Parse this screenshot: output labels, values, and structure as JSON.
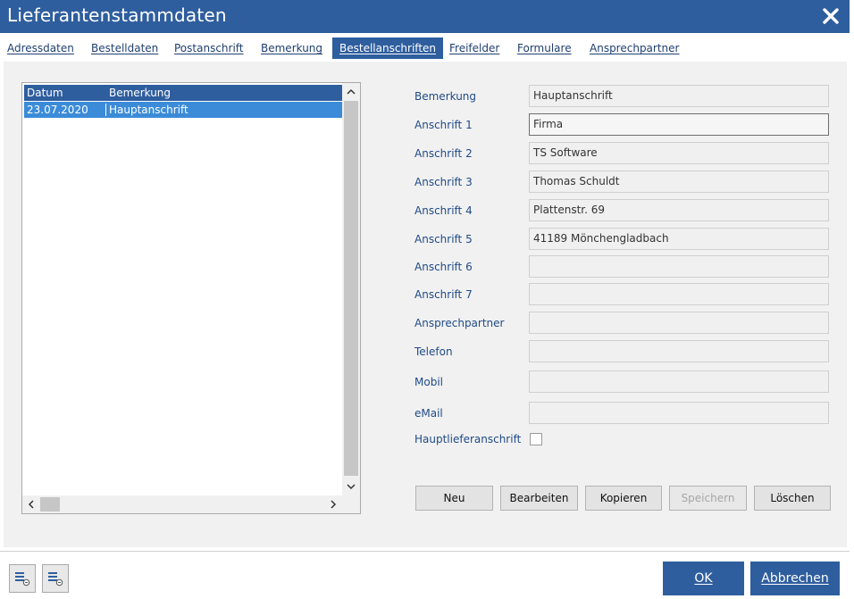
{
  "window": {
    "title": "Lieferantenstammdaten"
  },
  "tabs": [
    {
      "label": "Adressdaten"
    },
    {
      "label": "Bestelldaten"
    },
    {
      "label": "Postanschrift"
    },
    {
      "label": "Bemerkung"
    },
    {
      "label": "Bestellanschriften",
      "active": true
    },
    {
      "label": "Freifelder"
    },
    {
      "label": "Formulare"
    },
    {
      "label": "Ansprechpartner"
    }
  ],
  "list": {
    "columns": [
      "Datum",
      "Bemerkung"
    ],
    "rows": [
      {
        "datum": "23.07.2020",
        "bemerkung": "Hauptanschrift",
        "selected": true
      }
    ]
  },
  "form": {
    "fields": [
      {
        "label": "Bemerkung",
        "value": "Hauptanschrift"
      },
      {
        "label": "Anschrift 1",
        "value": "Firma",
        "focused": true
      },
      {
        "label": "Anschrift 2",
        "value": "TS Software"
      },
      {
        "label": "Anschrift 3",
        "value": "Thomas Schuldt"
      },
      {
        "label": "Anschrift 4",
        "value": "Plattenstr. 69"
      },
      {
        "label": "Anschrift 5",
        "value": "41189 Mönchengladbach"
      },
      {
        "label": "Anschrift 6",
        "value": ""
      },
      {
        "label": "Anschrift 7",
        "value": ""
      },
      {
        "label": "Ansprechpartner",
        "value": ""
      },
      {
        "label": "Telefon",
        "value": ""
      },
      {
        "label": "Mobil",
        "value": ""
      },
      {
        "label": "eMail",
        "value": ""
      }
    ],
    "checkbox": {
      "label": "Hauptlieferanschrift",
      "checked": false
    }
  },
  "buttons": {
    "neu": "Neu",
    "bearbeiten": "Bearbeiten",
    "kopieren": "Kopieren",
    "speichern": "Speichern",
    "loeschen": "Löschen"
  },
  "dialog": {
    "ok": "OK",
    "cancel": "Abbrechen"
  },
  "colors": {
    "titlebar": "#2f5e9e",
    "selection": "#3b8bd8",
    "label": "#1f4a86",
    "content_bg": "#f1f1f1"
  },
  "icons": [
    "close-icon",
    "chevron-up-icon",
    "chevron-down-icon",
    "chevron-left-icon",
    "chevron-right-icon",
    "list-settings-icon"
  ]
}
